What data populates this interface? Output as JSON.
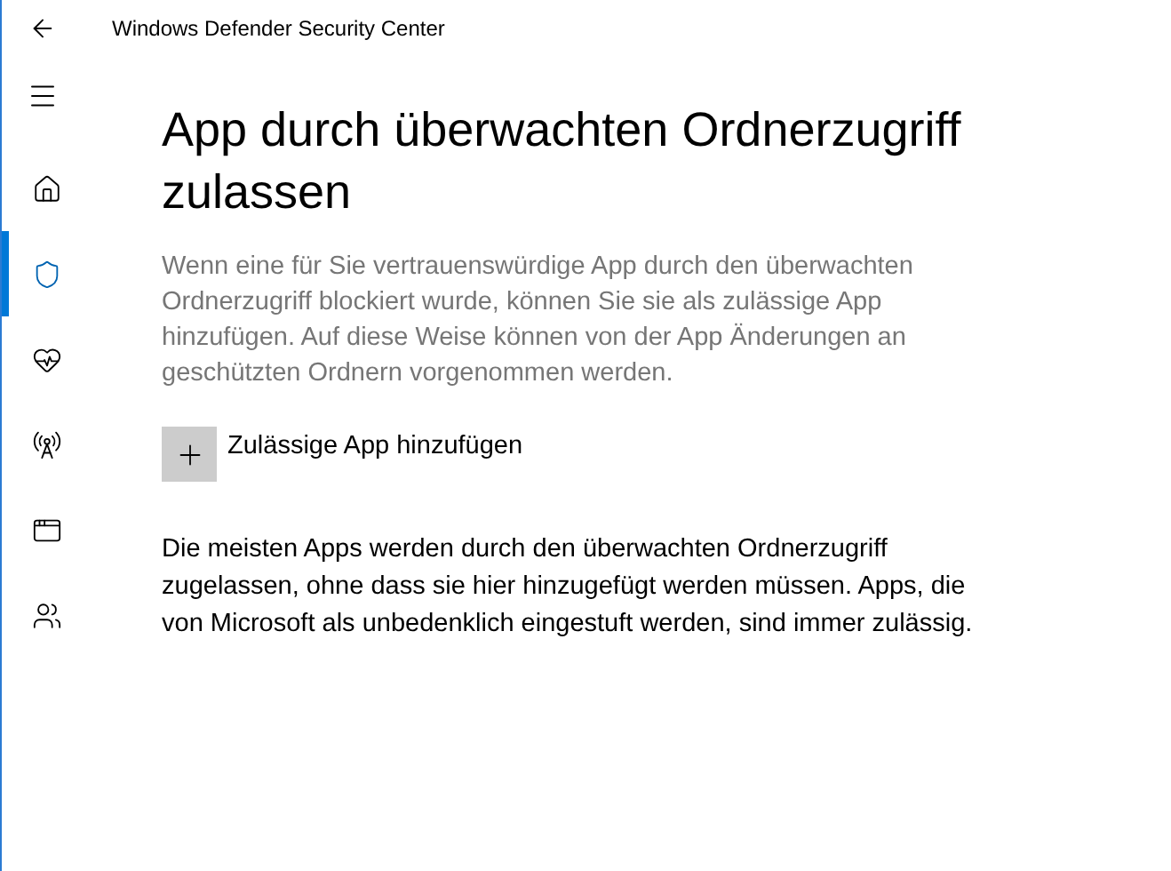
{
  "window": {
    "title": "Windows Defender Security Center"
  },
  "sidebar": {
    "items": [
      {
        "kind": "home",
        "selected": false
      },
      {
        "kind": "shield",
        "selected": true
      },
      {
        "kind": "health",
        "selected": false
      },
      {
        "kind": "network",
        "selected": false
      },
      {
        "kind": "app",
        "selected": false
      },
      {
        "kind": "family",
        "selected": false
      }
    ]
  },
  "page": {
    "heading": "App durch überwachten Ordnerzugriff zulassen",
    "description": "Wenn eine für Sie vertrauenswürdige App durch den überwachten Ordnerzugriff blockiert wurde, können Sie sie als zulässige App hinzufügen. Auf diese Weise können von der App Änderungen an geschützten Ordnern vorgenommen werden.",
    "add_button": "Zulässige App hinzufügen",
    "note": "Die meisten Apps werden durch den überwachten Ordnerzugriff zugelassen, ohne dass sie hier hinzugefügt werden müssen. Apps, die von Microsoft als unbedenklich eingestuft werden, sind immer zulässig."
  }
}
